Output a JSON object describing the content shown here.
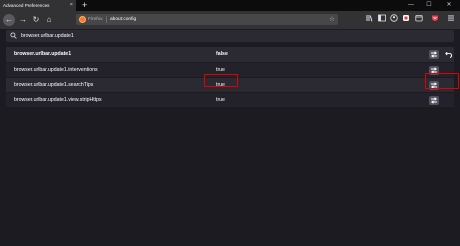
{
  "tab": {
    "title": "Advanced Preferences",
    "close_glyph": "×"
  },
  "new_tab_glyph": "+",
  "window_controls": {
    "minimize": "—",
    "maximize": "☐",
    "close": "✕"
  },
  "nav": {
    "back_glyph": "←",
    "forward_glyph": "→",
    "reload_glyph": "↻",
    "home_glyph": "⌂",
    "url_label": "Firefox",
    "url": "about:config",
    "bookmark_glyph": "☆"
  },
  "toolbar_icons": [
    "library-icon",
    "sidebar-icon",
    "account-icon",
    "extension-icon",
    "container-icon",
    "pocket-icon",
    "menu-icon"
  ],
  "search": {
    "value": "browser.urlbar.update1",
    "icon": "search-icon"
  },
  "prefs": [
    {
      "name": "browser.urlbar.update1",
      "value": "false",
      "modified": true
    },
    {
      "name": "browser.urlbar.update1.interventions",
      "value": "true",
      "modified": false
    },
    {
      "name": "browser.urlbar.update1.searchTips",
      "value": "true",
      "modified": false
    },
    {
      "name": "browser.urlbar.update1.view.stripHttps",
      "value": "true",
      "modified": false
    }
  ],
  "colors": {
    "highlight": "#e00000",
    "firefox_orange": "#ff7139"
  }
}
